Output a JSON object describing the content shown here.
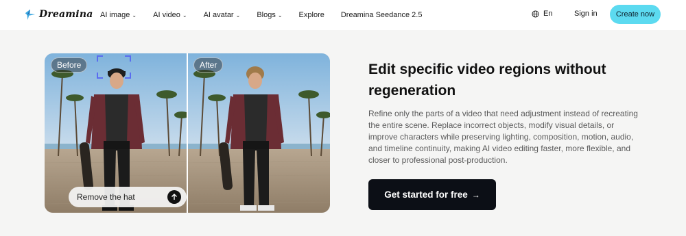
{
  "nav": {
    "logo_text": "Dreamina",
    "menu": [
      {
        "label": "AI image",
        "dropdown": true
      },
      {
        "label": "AI video",
        "dropdown": true
      },
      {
        "label": "AI avatar",
        "dropdown": true
      },
      {
        "label": "Blogs",
        "dropdown": true
      },
      {
        "label": "Explore",
        "dropdown": false
      },
      {
        "label": "Dreamina Seedance 2.5",
        "dropdown": false
      }
    ],
    "language": "En",
    "signin_label": "Sign in",
    "create_label": "Create now"
  },
  "media": {
    "before_label": "Before",
    "after_label": "After",
    "prompt_text": "Remove the hat"
  },
  "hero": {
    "title": "Edit specific video regions without regeneration",
    "description": "Refine only the parts of a video that need adjustment instead of recreating the entire scene. Replace incorrect objects, modify visual details, or improve characters while preserving lighting, composition, motion, audio, and timeline continuity, making AI video editing faster, more flexible, and closer to professional post-production.",
    "cta_label": "Get started for free",
    "cta_arrow": "→"
  },
  "colors": {
    "accent": "#5cdaf0",
    "cta_bg": "#0c0f16",
    "page_bg": "#f5f5f4"
  },
  "icons": {
    "logo": "dreamina-star-icon",
    "language": "globe-icon",
    "send": "arrow-up-icon",
    "menu_dropdown": "chevron-down-icon"
  }
}
